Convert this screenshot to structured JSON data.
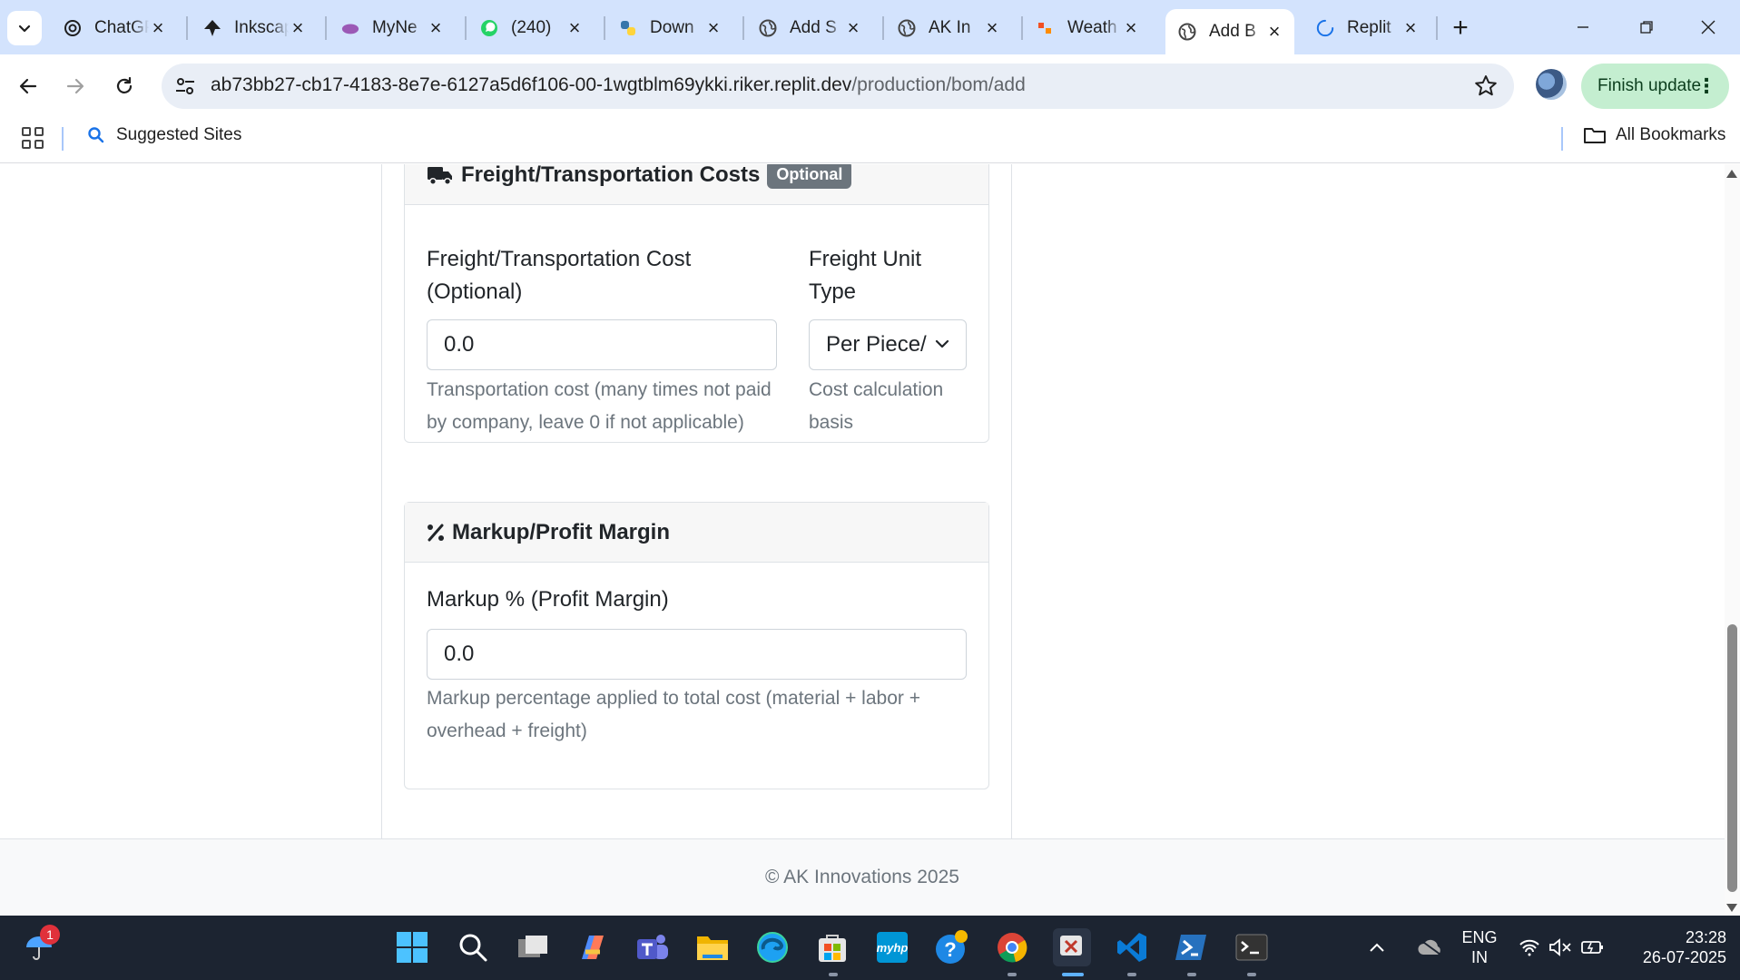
{
  "browser": {
    "tabs": [
      {
        "title": "ChatGPT",
        "icon": "chatgpt-icon"
      },
      {
        "title": "Inkscape",
        "icon": "inkscape-icon"
      },
      {
        "title": "MyNe",
        "icon": "myne-icon"
      },
      {
        "title": "(240)",
        "icon": "whatsapp-icon"
      },
      {
        "title": "Down",
        "icon": "python-icon"
      },
      {
        "title": "Add S",
        "icon": "globe-icon"
      },
      {
        "title": "AK In",
        "icon": "globe-icon"
      },
      {
        "title": "Weath",
        "icon": "weather-icon"
      },
      {
        "title": "Add B",
        "icon": "globe-icon",
        "active": true
      },
      {
        "title": "Replit",
        "icon": "loading-icon"
      }
    ],
    "url_host": "ab73bb27-cb17-4183-8e7e-6127a5d6f106-00-1wgtblm69ykki.riker.replit.dev",
    "url_path": "/production/bom/add",
    "finish_update_label": "Finish update",
    "bookmarks": {
      "suggested": "Suggested Sites",
      "all": "All Bookmarks"
    }
  },
  "page": {
    "freight": {
      "heading": "Freight/Transportation Costs",
      "badge": "Optional",
      "cost_label_line1": "Freight/Transportation Cost",
      "cost_label_line2": "(Optional)",
      "cost_value": "0.0",
      "cost_help_line1": "Transportation cost (many times not paid",
      "cost_help_line2": "by company, leave 0 if not applicable)",
      "unit_label_line1": "Freight Unit",
      "unit_label_line2": "Type",
      "unit_value": "Per Piece/",
      "unit_help_line1": "Cost calculation",
      "unit_help_line2": "basis"
    },
    "markup": {
      "heading": "Markup/Profit Margin",
      "label": "Markup % (Profit Margin)",
      "value": "0.0",
      "help_line1": "Markup percentage applied to total cost (material + labor +",
      "help_line2": "overhead + freight)"
    },
    "footer": "© AK Innovations 2025"
  },
  "taskbar": {
    "notification_count": "1",
    "language": "ENG",
    "region": "IN",
    "time": "23:28",
    "date": "26-07-2025"
  }
}
